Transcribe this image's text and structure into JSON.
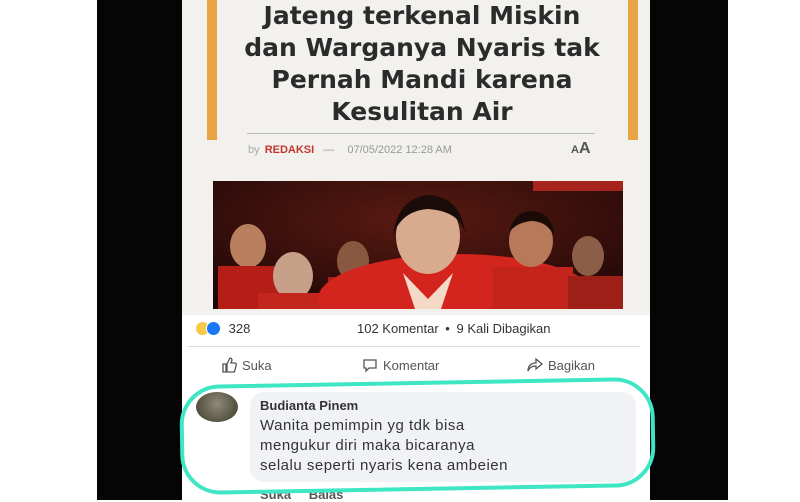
{
  "article": {
    "title_lines": [
      "Jateng terkenal Miskin",
      "dan Warganya Nyaris tak",
      "Pernah Mandi karena",
      "Kesulitan Air"
    ],
    "byline": {
      "by": "by",
      "author": "REDAKSI",
      "dash": "—",
      "date": "07/05/2022 12:28 AM"
    },
    "font_control": {
      "small": "A",
      "large": "A"
    }
  },
  "post": {
    "reaction_count": "328",
    "comments": "102 Komentar",
    "separator": "•",
    "shares": "9 Kali Dibagikan",
    "actions": {
      "like": "Suka",
      "comment": "Komentar",
      "share": "Bagikan"
    }
  },
  "comment": {
    "author": "Budianta Pinem",
    "lines": [
      "Wanita pemimpin yg tdk bisa",
      "mengukur diri maka bicaranya",
      "selalu seperti nyaris kena ambeien"
    ],
    "actions": {
      "like": "Suka",
      "reply": "Balas"
    }
  },
  "colors": {
    "highlight": "#3ee6c4",
    "accent_stripe": "#e9a544",
    "author_red": "#c3352e",
    "fb_blue": "#1877f2"
  }
}
